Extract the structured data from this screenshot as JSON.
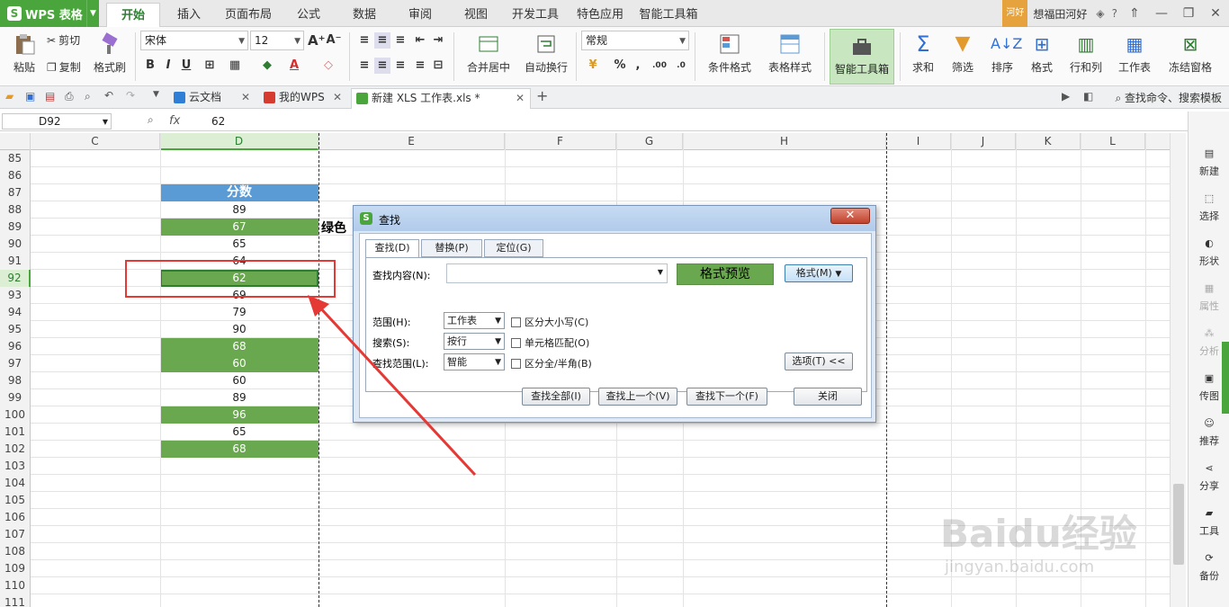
{
  "app": {
    "name": "WPS 表格",
    "logo_letter": "S"
  },
  "menu_tabs": [
    "开始",
    "插入",
    "页面布局",
    "公式",
    "数据",
    "审阅",
    "视图",
    "开发工具",
    "特色应用",
    "智能工具箱"
  ],
  "user": {
    "badge": "河好",
    "greeting": "想福田河好"
  },
  "ribbon": {
    "paste": "粘贴",
    "cut": "剪切",
    "copy": "复制",
    "format_painter": "格式刷",
    "font_name": "宋体",
    "font_size": "12",
    "bold": "B",
    "italic": "I",
    "underline": "U",
    "merge_center": "合并居中",
    "wrap_text": "自动换行",
    "number_format": "常规",
    "conditional_format": "条件格式",
    "table_style": "表格样式",
    "smart_toolbox": "智能工具箱",
    "sum": "求和",
    "filter": "筛选",
    "sort": "排序",
    "format": "格式",
    "rows_cols": "行和列",
    "worksheet": "工作表",
    "freeze": "冻结窗格"
  },
  "doc_tabs": [
    {
      "label": "云文档",
      "color": "#2f7fd6"
    },
    {
      "label": "我的WPS",
      "color": "#d63b2f"
    },
    {
      "label": "新建 XLS 工作表.xls *",
      "color": "#4aa63c"
    }
  ],
  "search_command": "查找命令、搜索模板",
  "formula_bar": {
    "cell_ref": "D92",
    "fx": "fx",
    "value": "62"
  },
  "columns": [
    "C",
    "D",
    "E",
    "F",
    "G",
    "H",
    "I",
    "J",
    "K",
    "L"
  ],
  "rows": [
    {
      "n": "85",
      "d": "",
      "style": ""
    },
    {
      "n": "86",
      "d": "",
      "style": ""
    },
    {
      "n": "87",
      "d": "分数",
      "style": "header"
    },
    {
      "n": "88",
      "d": "89",
      "style": ""
    },
    {
      "n": "89",
      "d": "67",
      "style": "green"
    },
    {
      "n": "90",
      "d": "65",
      "style": ""
    },
    {
      "n": "91",
      "d": "64",
      "style": ""
    },
    {
      "n": "92",
      "d": "62",
      "style": "green"
    },
    {
      "n": "93",
      "d": "69",
      "style": ""
    },
    {
      "n": "94",
      "d": "79",
      "style": ""
    },
    {
      "n": "95",
      "d": "90",
      "style": ""
    },
    {
      "n": "96",
      "d": "68",
      "style": "green"
    },
    {
      "n": "97",
      "d": "60",
      "style": "green"
    },
    {
      "n": "98",
      "d": "60",
      "style": ""
    },
    {
      "n": "99",
      "d": "89",
      "style": ""
    },
    {
      "n": "100",
      "d": "96",
      "style": "green"
    },
    {
      "n": "101",
      "d": "65",
      "style": ""
    },
    {
      "n": "102",
      "d": "68",
      "style": "green"
    },
    {
      "n": "103",
      "d": "",
      "style": ""
    },
    {
      "n": "104",
      "d": "",
      "style": ""
    },
    {
      "n": "105",
      "d": "",
      "style": ""
    },
    {
      "n": "106",
      "d": "",
      "style": ""
    },
    {
      "n": "107",
      "d": "",
      "style": ""
    },
    {
      "n": "108",
      "d": "",
      "style": ""
    },
    {
      "n": "109",
      "d": "",
      "style": ""
    },
    {
      "n": "110",
      "d": "",
      "style": ""
    },
    {
      "n": "111",
      "d": "",
      "style": ""
    }
  ],
  "selected_row": "92",
  "selected_col": "D",
  "overflow_text": "绿色",
  "dialog": {
    "title": "查找",
    "close": "✕",
    "tabs": [
      "查找(D)",
      "替换(P)",
      "定位(G)"
    ],
    "find_label": "查找内容(N):",
    "find_value": "",
    "preview": "格式预览",
    "format_btn": "格式(M)",
    "scope_label": "范围(H):",
    "scope_value": "工作表",
    "search_label": "搜索(S):",
    "search_value": "按行",
    "lookin_label": "查找范围(L):",
    "lookin_value": "智能",
    "match_case": "区分大小写(C)",
    "match_cell": "单元格匹配(O)",
    "match_width": "区分全/半角(B)",
    "options_btn": "选项(T) <<",
    "find_all": "查找全部(I)",
    "find_prev": "查找上一个(V)",
    "find_next": "查找下一个(F)",
    "close_btn": "关闭"
  },
  "sidebar": [
    {
      "label": "新建",
      "dim": false
    },
    {
      "label": "选择",
      "dim": false
    },
    {
      "label": "形状",
      "dim": false
    },
    {
      "label": "属性",
      "dim": true
    },
    {
      "label": "分析",
      "dim": true
    },
    {
      "label": "传图",
      "dim": false
    },
    {
      "label": "推荐",
      "dim": false
    },
    {
      "label": "分享",
      "dim": false
    },
    {
      "label": "工具",
      "dim": false
    },
    {
      "label": "备份",
      "dim": false
    }
  ],
  "watermark": {
    "main": "Baidu经验",
    "sub": "jingyan.baidu.com"
  }
}
